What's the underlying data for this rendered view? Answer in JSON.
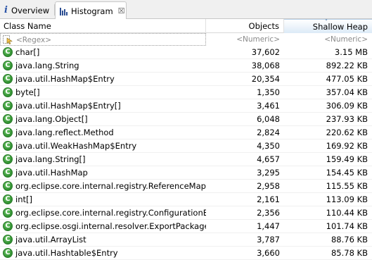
{
  "tabs": [
    {
      "label": "Overview",
      "icon": "info-icon"
    },
    {
      "label": "Histogram",
      "icon": "histogram-icon",
      "active": true,
      "close_glyph": "☒"
    }
  ],
  "table": {
    "columns": [
      "Class Name",
      "Objects",
      "Shallow Heap"
    ],
    "sorted_column": "Shallow Heap",
    "filters": {
      "class": "<Regex>",
      "objects": "<Numeric>",
      "shallow": "<Numeric>"
    },
    "class_icon_letter": "C",
    "rows": [
      {
        "name": "char[]",
        "objects": "37,602",
        "shallow": "3.15 MB"
      },
      {
        "name": "java.lang.String",
        "objects": "38,068",
        "shallow": "892.22 KB"
      },
      {
        "name": "java.util.HashMap$Entry",
        "objects": "20,354",
        "shallow": "477.05 KB"
      },
      {
        "name": "byte[]",
        "objects": "1,350",
        "shallow": "357.04 KB"
      },
      {
        "name": "java.util.HashMap$Entry[]",
        "objects": "3,461",
        "shallow": "306.09 KB"
      },
      {
        "name": "java.lang.Object[]",
        "objects": "6,048",
        "shallow": "237.93 KB"
      },
      {
        "name": "java.lang.reflect.Method",
        "objects": "2,824",
        "shallow": "220.62 KB"
      },
      {
        "name": "java.util.WeakHashMap$Entry",
        "objects": "4,350",
        "shallow": "169.92 KB"
      },
      {
        "name": "java.lang.String[]",
        "objects": "4,657",
        "shallow": "159.49 KB"
      },
      {
        "name": "java.util.HashMap",
        "objects": "3,295",
        "shallow": "154.45 KB"
      },
      {
        "name": "org.eclipse.core.internal.registry.ReferenceMap$...",
        "objects": "2,958",
        "shallow": "115.55 KB"
      },
      {
        "name": "int[]",
        "objects": "2,161",
        "shallow": "113.09 KB"
      },
      {
        "name": "org.eclipse.core.internal.registry.ConfigurationEl...",
        "objects": "2,356",
        "shallow": "110.44 KB"
      },
      {
        "name": "org.eclipse.osgi.internal.resolver.ExportPackageD...",
        "objects": "1,447",
        "shallow": "101.74 KB"
      },
      {
        "name": "java.util.ArrayList",
        "objects": "3,787",
        "shallow": "88.76 KB"
      },
      {
        "name": "java.util.Hashtable$Entry",
        "objects": "3,660",
        "shallow": "85.78 KB"
      }
    ]
  },
  "colors": {
    "class_icon": "#3a9a3a",
    "sorted_header": "#dceaf7",
    "info_icon": "#2b55a8"
  }
}
